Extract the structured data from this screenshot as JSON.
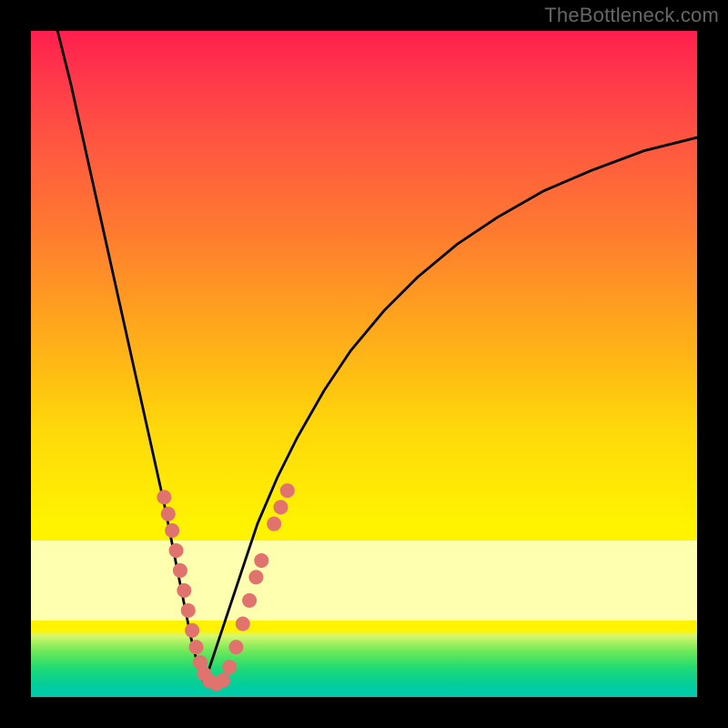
{
  "watermark": "TheBottleneck.com",
  "chart_data": {
    "type": "line",
    "title": "",
    "xlabel": "",
    "ylabel": "",
    "xlim": [
      0,
      100
    ],
    "ylim": [
      0,
      100
    ],
    "grid": false,
    "series": [
      {
        "name": "left-curve",
        "x": [
          4,
          6,
          8,
          10,
          12,
          14,
          16,
          18,
          20,
          21,
          22,
          23,
          24,
          25,
          26
        ],
        "values": [
          100,
          92,
          83,
          74,
          65,
          56,
          47,
          38,
          29,
          24,
          19,
          14,
          9,
          5,
          2
        ]
      },
      {
        "name": "right-curve",
        "x": [
          26,
          28,
          30,
          32,
          34,
          37,
          40,
          44,
          48,
          53,
          58,
          64,
          70,
          77,
          84,
          92,
          100
        ],
        "values": [
          2,
          8,
          14,
          20,
          26,
          33,
          39,
          46,
          52,
          58,
          63,
          68,
          72,
          76,
          79,
          82,
          84
        ]
      }
    ],
    "markers": {
      "name": "salmon-dots",
      "color": "#e0736e",
      "points": [
        {
          "x": 20.0,
          "y": 30.0
        },
        {
          "x": 20.6,
          "y": 27.5
        },
        {
          "x": 21.2,
          "y": 25.0
        },
        {
          "x": 21.8,
          "y": 22.0
        },
        {
          "x": 22.4,
          "y": 19.0
        },
        {
          "x": 23.0,
          "y": 16.0
        },
        {
          "x": 23.6,
          "y": 13.0
        },
        {
          "x": 24.2,
          "y": 10.0
        },
        {
          "x": 24.8,
          "y": 7.5
        },
        {
          "x": 25.4,
          "y": 5.2
        },
        {
          "x": 26.0,
          "y": 3.5
        },
        {
          "x": 26.8,
          "y": 2.4
        },
        {
          "x": 27.8,
          "y": 2.0
        },
        {
          "x": 28.8,
          "y": 2.5
        },
        {
          "x": 29.8,
          "y": 4.5
        },
        {
          "x": 30.8,
          "y": 7.5
        },
        {
          "x": 31.8,
          "y": 11.0
        },
        {
          "x": 32.8,
          "y": 14.5
        },
        {
          "x": 33.8,
          "y": 18.0
        },
        {
          "x": 34.6,
          "y": 20.5
        },
        {
          "x": 36.5,
          "y": 26.0
        },
        {
          "x": 37.5,
          "y": 28.5
        },
        {
          "x": 38.5,
          "y": 31.0
        }
      ]
    },
    "gradient_bands": [
      {
        "from": 0,
        "to": 76.5,
        "kind": "red-to-yellow"
      },
      {
        "from": 76.5,
        "to": 88.5,
        "kind": "pale-yellow"
      },
      {
        "from": 88.5,
        "to": 90.0,
        "kind": "yellow"
      },
      {
        "from": 90.0,
        "to": 100,
        "kind": "green-gradient"
      }
    ]
  }
}
